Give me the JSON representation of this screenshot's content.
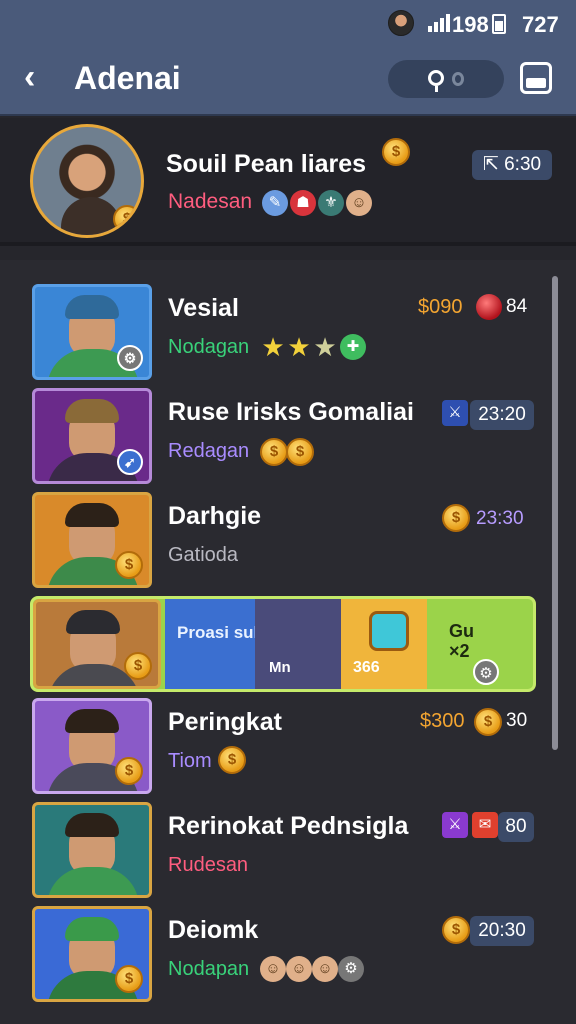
{
  "status": {
    "number": "198",
    "time": "727"
  },
  "appbar": {
    "title": "Adenai"
  },
  "profile": {
    "name": "Souil Pean liares",
    "subtitle": "Nadesan",
    "time": "6:30"
  },
  "items": [
    {
      "name": "Vesial",
      "sub": "Nodagan",
      "price": "$090",
      "value": "84"
    },
    {
      "name": "Ruse Irisks Gomaliai",
      "sub": "Redagan",
      "time": "23:20"
    },
    {
      "name": "Darhgie",
      "sub": "Gatioda",
      "time": "23:30"
    },
    {
      "name": "Peringkat",
      "sub": "Tiom",
      "price": "$300",
      "value": "30"
    },
    {
      "name": "Rerinokat Pednsigla",
      "sub": "Rudesan",
      "value": "80"
    },
    {
      "name": "Deiomk",
      "sub": "Nodapan",
      "time": "20:30"
    }
  ],
  "featured": {
    "text1": "Proasi sulhleas",
    "text2": "Mn",
    "text3": "366",
    "text4": "Gu",
    "text5": "×2"
  },
  "colors": {
    "header": "#4a5a7a",
    "accent": "#f3a531",
    "green": "#39d27a",
    "pink": "#ff5d7f",
    "violet": "#a98cff"
  }
}
